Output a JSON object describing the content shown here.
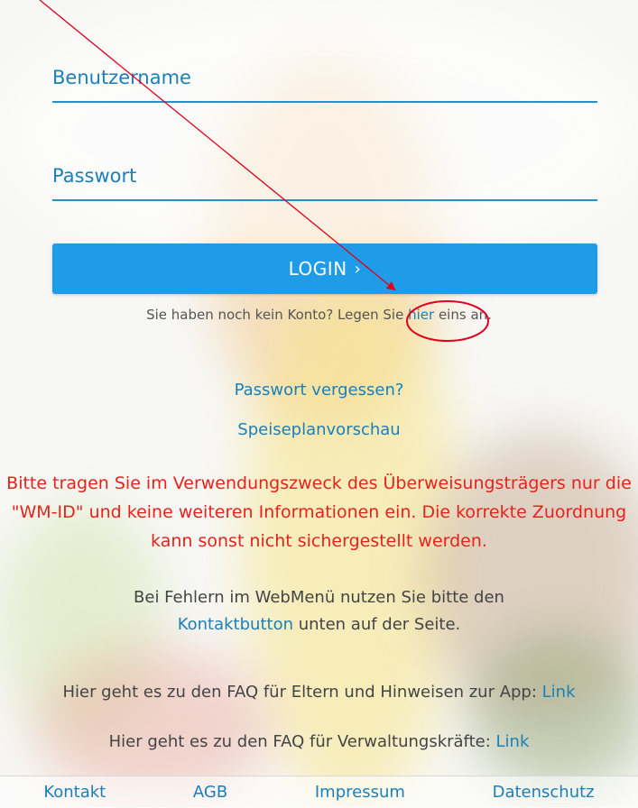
{
  "login": {
    "username_label": "Benutzername",
    "password_label": "Passwort",
    "button_label": "LOGIN",
    "button_chevron": "›",
    "register_prefix": "Sie haben noch kein Konto? Legen Sie ",
    "register_link": "hier",
    "register_suffix": " eins an."
  },
  "links": {
    "forgot_password": "Passwort vergessen?",
    "menu_preview": "Speiseplanvorschau"
  },
  "notice": {
    "warning_text": "Bitte tragen Sie im Verwendungszweck des Überweisungsträgers nur die \"WM-ID\" und keine weiteren Informationen ein. Die korrekte Zuordnung kann sonst nicht sichergestellt werden."
  },
  "help": {
    "errors_prefix": "Bei Fehlern im WebMenü nutzen Sie bitte den",
    "errors_link": "Kontaktbutton",
    "errors_suffix": " unten auf der Seite.",
    "faq_parents_text": "Hier geht es zu den FAQ für Eltern und Hinweisen zur App: ",
    "faq_parents_link": "Link",
    "faq_admin_text": "Hier geht es zu den FAQ für Verwaltungskräfte: ",
    "faq_admin_link": "Link"
  },
  "footer": {
    "items": [
      "Kontakt",
      "AGB",
      "Impressum",
      "Datenschutz"
    ]
  },
  "colors": {
    "accent": "#1f9ce8",
    "link": "#1b7fb8",
    "warning": "#e5231b",
    "annotation": "#e0001b"
  },
  "icons": {
    "login_chevron": "chevron-right-icon"
  }
}
